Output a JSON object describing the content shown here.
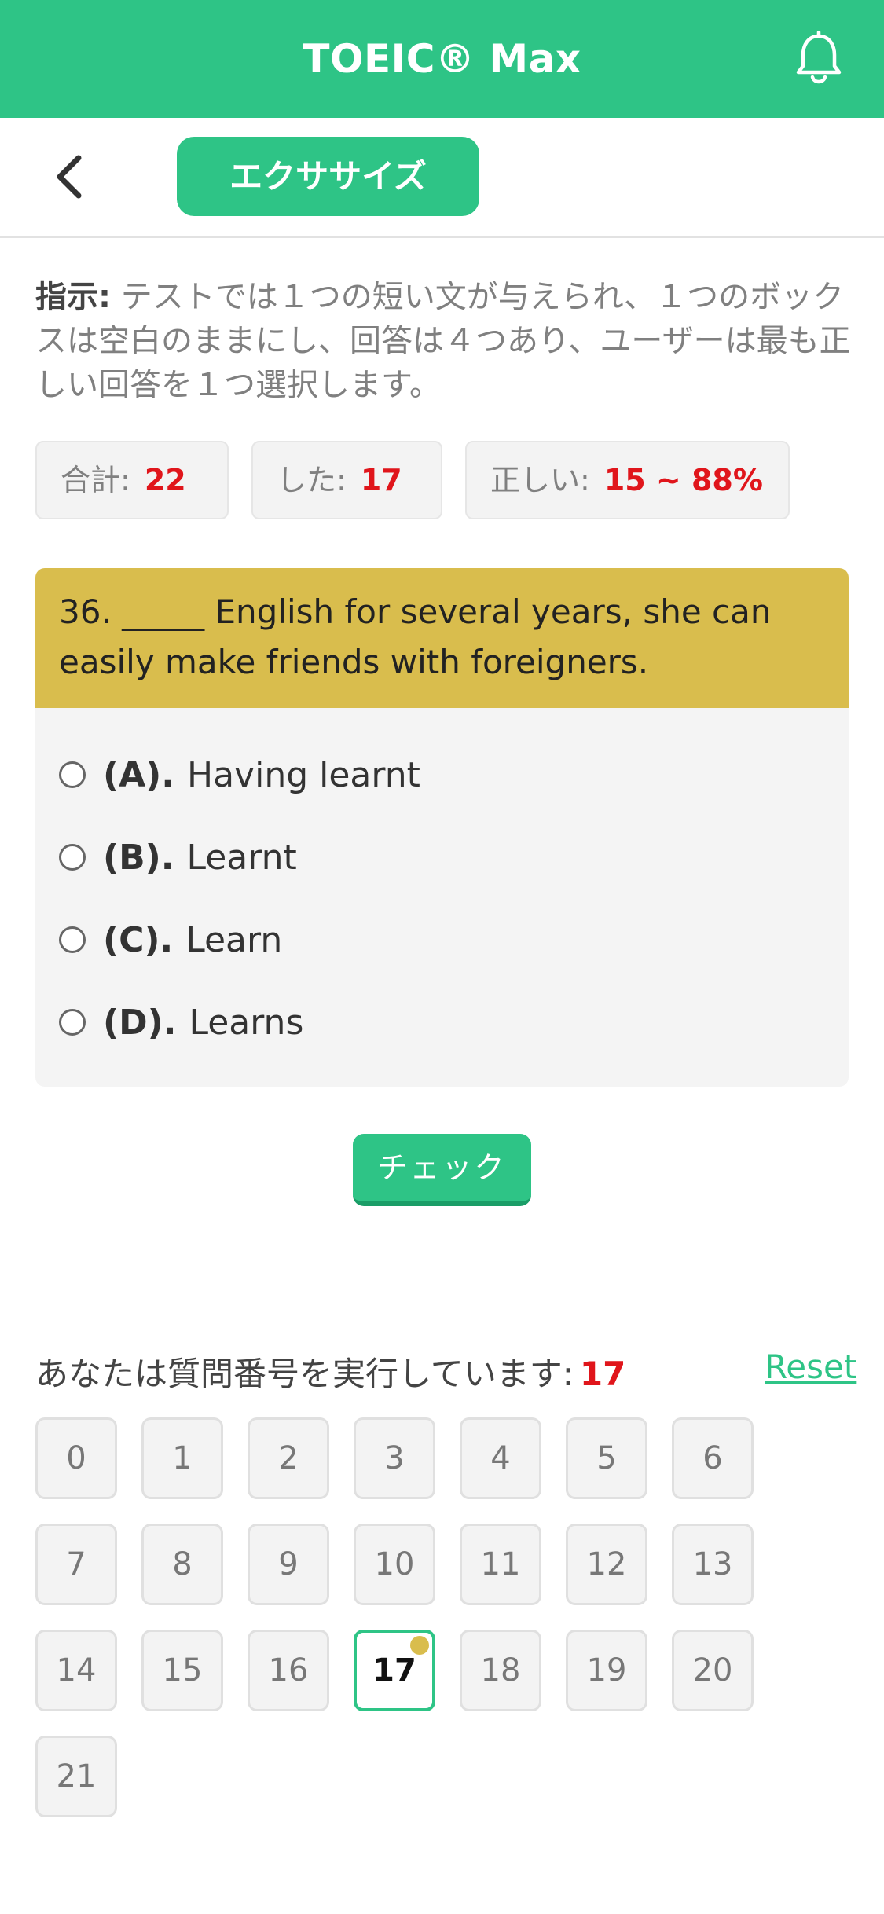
{
  "header": {
    "title": "TOEIC® Max",
    "bell_icon": "bell-icon"
  },
  "subheader": {
    "back_icon": "chevron-left-icon",
    "mode_label": "エクササイズ"
  },
  "instructions": {
    "label": "指示:",
    "text": " テストでは１つの短い文が与えられ、１つのボックスは空白のままにし、回答は４つあり、ユーザーは最も正しい回答を１つ選択します。"
  },
  "stats": {
    "total_label": "合計:",
    "total_value": "22",
    "done_label": "した:",
    "done_value": "17",
    "correct_label": "正しい:",
    "correct_value": "15 ~ 88%"
  },
  "question": {
    "text": "36. _____ English for several years, she can easily make friends with foreigners.",
    "options": [
      {
        "letter": "(A).",
        "text": "Having learnt"
      },
      {
        "letter": "(B).",
        "text": "Learnt"
      },
      {
        "letter": "(C).",
        "text": "Learn"
      },
      {
        "letter": "(D).",
        "text": "Learns"
      }
    ]
  },
  "check_label": "チェック",
  "navigator": {
    "running_label": "あなたは質問番号を実行しています:",
    "current": "17",
    "reset_label": "Reset",
    "numbers": [
      "0",
      "1",
      "2",
      "3",
      "4",
      "5",
      "6",
      "7",
      "8",
      "9",
      "10",
      "11",
      "12",
      "13",
      "14",
      "15",
      "16",
      "17",
      "18",
      "19",
      "20",
      "21"
    ],
    "active_index": 17
  },
  "colors": {
    "primary": "#2ec486",
    "question_bg": "#d9bd4d",
    "accent_red": "#e0151b"
  }
}
